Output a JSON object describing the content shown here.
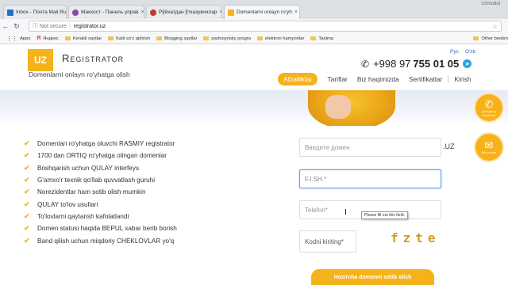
{
  "browser": {
    "tabs": [
      {
        "label": "Inbox - Почта Mail.Ru",
        "icon": "mail-icon",
        "color": "#1a73c8"
      },
      {
        "label": "Макхост - Панель управ",
        "icon": "heart-icon",
        "color": "#8e44ad"
      },
      {
        "label": "Рўйхатдан ўтказувчилар",
        "icon": "globe-icon",
        "color": "#c0392b"
      },
      {
        "label": "Domenlarni onlayn ro'yh",
        "icon": "uz-icon",
        "color": "#f6b21a"
      }
    ],
    "profile": "Uzmodul",
    "security_label": "Not secure",
    "url": "registrator.uz",
    "bookmarks": [
      {
        "label": "Apps",
        "icon": "apps-icon"
      },
      {
        "label": "Яндекс",
        "icon": "yandex-icon"
      },
      {
        "label": "Kerakli saytlar",
        "icon": "folder-icon"
      },
      {
        "label": "Kalit so'z qidirish",
        "icon": "folder-icon"
      },
      {
        "label": "Blogging saytlar",
        "icon": "folder-icon"
      },
      {
        "label": "partnoyrisky progra",
        "icon": "folder-icon"
      },
      {
        "label": "elektron hamyonlar",
        "icon": "folder-icon"
      },
      {
        "label": "Tarjima",
        "icon": "folder-icon"
      }
    ],
    "bookmarks_right": "Other bookm"
  },
  "site": {
    "logo": "UZ",
    "brand": "Registrator",
    "tagline": "Domenlarni onlayn ro'yhatga olish",
    "lang": [
      "Рус",
      "O'zb"
    ],
    "phone_prefix": "+998 97",
    "phone_main": "755 01 05",
    "nav": [
      "Afzalliklar",
      "Tariflar",
      "Biz haqimizda",
      "Sertifikatlar",
      "Kirish"
    ],
    "float_buttons": [
      {
        "label": "Qo'ng'iroq buyurtma",
        "icon": "phone-icon"
      },
      {
        "label": "Biz yozish",
        "icon": "envelope-icon"
      }
    ],
    "features": [
      "Domenlari ro'yhatga oluvchi RASMIY registrator",
      "1700 dan ORTIQ ro'yhatga olingan domenlar",
      "Boshqarish uchun QULAY interfeys",
      "G'amxo'r texnik qo'llab quvvatlash guruhi",
      "Norezidentlar ham sotib olish mumkin",
      "QULAY to'lov usullari",
      "To'lovlarni qaytarish kafolatlandi",
      "Domen statusi haqida BEPUL xabar berib borish",
      "Band qilish uchun miqdoriy CHEKLOVLAR yo'q"
    ],
    "form": {
      "domain_placeholder": "Введите домен",
      "domain_suffix": ".UZ",
      "fio_placeholder": "F.I.SH.*",
      "phone_placeholder": "Telefon*",
      "captcha_placeholder": "Kodni kiriting*",
      "captcha_text": "fzte",
      "tooltip": "Please fill out this field.",
      "submit": "Hozircha domenni sotib olish"
    }
  },
  "colors": {
    "accent": "#f6b21a",
    "link": "#1a73c8"
  }
}
